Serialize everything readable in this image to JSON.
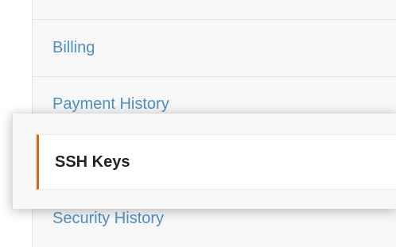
{
  "menu": {
    "items": [
      {
        "label": "Billing"
      },
      {
        "label": "Payment History"
      },
      {
        "label": "SSH Keys",
        "selected": true
      },
      {
        "label": "Security History"
      }
    ]
  },
  "colors": {
    "link": "#4d8fc7",
    "selected_text": "#222222",
    "selected_accent": "#d26911",
    "panel_bg": "#f7f7f7"
  }
}
